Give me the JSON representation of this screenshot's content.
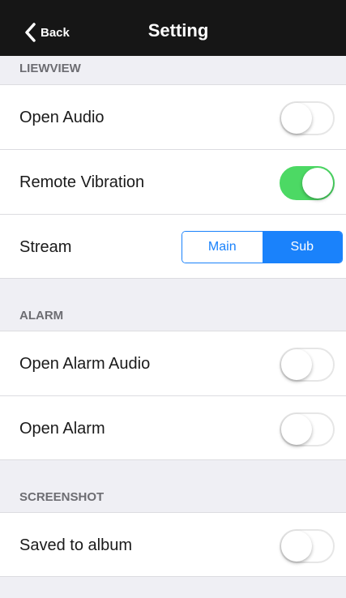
{
  "nav": {
    "back_label": "Back",
    "title": "Setting"
  },
  "sections": {
    "liveview": {
      "header": "LIEWVIEW",
      "open_audio": {
        "label": "Open Audio",
        "on": false
      },
      "remote_vibration": {
        "label": "Remote Vibration",
        "on": true
      },
      "stream": {
        "label": "Stream",
        "options": [
          "Main",
          "Sub"
        ],
        "selected": "Sub"
      }
    },
    "alarm": {
      "header": "ALARM",
      "open_alarm_audio": {
        "label": "Open Alarm Audio",
        "on": false
      },
      "open_alarm": {
        "label": "Open Alarm",
        "on": false
      }
    },
    "screenshot": {
      "header": "SCREENSHOT",
      "saved_to_album": {
        "label": "Saved to album",
        "on": false
      }
    }
  },
  "colors": {
    "accent": "#1a82fb",
    "toggle_on": "#4cd964",
    "nav_bg": "#161616",
    "group_bg": "#efeff4"
  }
}
